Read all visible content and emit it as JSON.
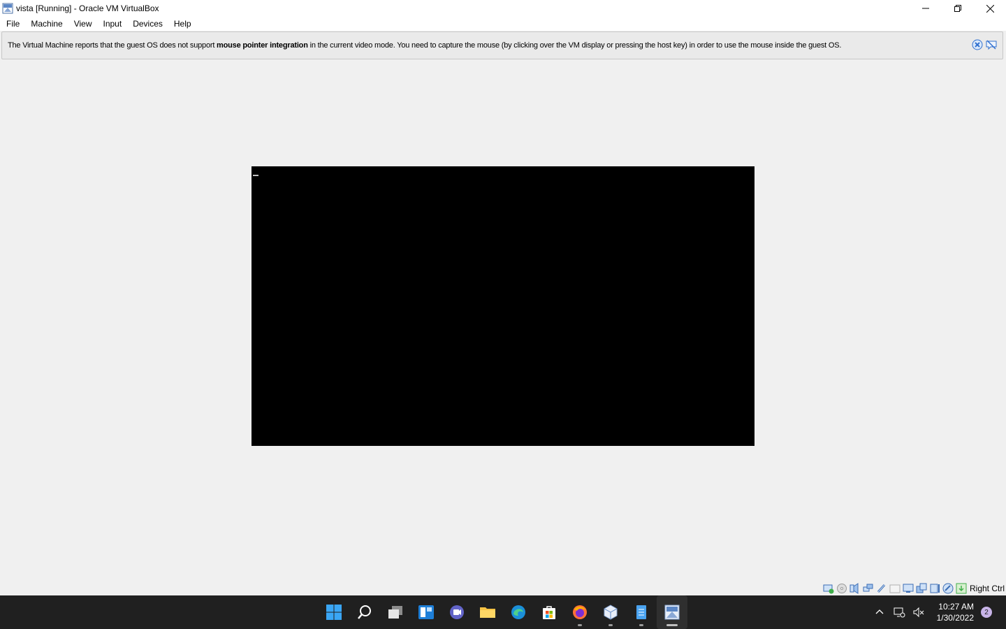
{
  "window": {
    "title": "vista [Running] - Oracle VM VirtualBox"
  },
  "menu": [
    "File",
    "Machine",
    "View",
    "Input",
    "Devices",
    "Help"
  ],
  "banner": {
    "text_before": "The Virtual Machine reports that the guest OS does not support ",
    "text_bold": "mouse pointer integration",
    "text_after": " in the current video mode. You need to capture the mouse (by clicking over the VM display or pressing the host key) in order to use the mouse inside the guest OS."
  },
  "statusbar": {
    "host_key": "Right Ctrl",
    "icons": [
      "hard-disk-icon",
      "optical-drive-icon",
      "audio-icon",
      "network-icon",
      "usb-icon",
      "shared-folders-icon",
      "display-icon",
      "video-capture-icon",
      "cpu-icon",
      "mouse-integration-icon",
      "keyboard-capture-icon"
    ]
  },
  "taskbar": {
    "apps": [
      "start-icon",
      "search-icon",
      "task-view-icon",
      "widgets-icon",
      "chat-icon",
      "file-explorer-icon",
      "edge-icon",
      "store-icon",
      "firefox-icon",
      "virtualbox-icon",
      "notepad-icon",
      "vm-window-icon"
    ],
    "time": "10:27 AM",
    "date": "1/30/2022",
    "notification_count": "2"
  },
  "colors": {
    "taskbar_bg": "#202020",
    "window_bg": "#f0f0f0",
    "vm_screen": "#000000"
  }
}
